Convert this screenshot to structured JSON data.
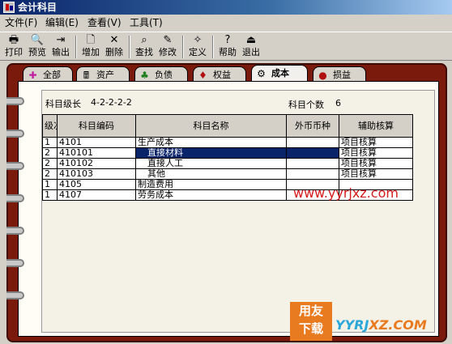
{
  "window": {
    "title": "会计科目"
  },
  "menu": [
    {
      "label": "文件(F)"
    },
    {
      "label": "编辑(E)"
    },
    {
      "label": "查看(V)"
    },
    {
      "label": "工具(T)"
    }
  ],
  "toolbar": {
    "print": "打印",
    "preview": "预览",
    "export": "输出",
    "add": "增加",
    "delete": "删除",
    "find": "查找",
    "modify": "修改",
    "define": "定义",
    "help": "帮助",
    "exit": "退出"
  },
  "tabs": [
    {
      "label": "全部",
      "icon": "all-icon"
    },
    {
      "label": "资产",
      "icon": "asset-icon"
    },
    {
      "label": "负债",
      "icon": "liability-icon"
    },
    {
      "label": "权益",
      "icon": "equity-icon"
    },
    {
      "label": "成本",
      "icon": "cost-icon",
      "active": true
    },
    {
      "label": "损益",
      "icon": "profit-loss-icon"
    }
  ],
  "info": {
    "level_length_label": "科目级长",
    "level_length_value": "4-2-2-2-2",
    "count_label": "科目个数",
    "count_value": "6"
  },
  "table": {
    "headers": [
      "级次",
      "科目编码",
      "科目名称",
      "外币币种",
      "辅助核算"
    ],
    "rows": [
      {
        "level": "1",
        "code": "4101",
        "name": "生产成本",
        "currency": "",
        "aux": "项目核算"
      },
      {
        "level": "2",
        "code": "410101",
        "name": "直接材料",
        "currency": "",
        "aux": "项目核算",
        "selected": true
      },
      {
        "level": "2",
        "code": "410102",
        "name": "直接人工",
        "currency": "",
        "aux": "项目核算"
      },
      {
        "level": "2",
        "code": "410103",
        "name": "其他",
        "currency": "",
        "aux": "项目核算"
      },
      {
        "level": "1",
        "code": "4105",
        "name": "制造费用",
        "currency": "",
        "aux": ""
      },
      {
        "level": "1",
        "code": "4107",
        "name": "劳务成本",
        "currency": "",
        "aux": ""
      }
    ]
  },
  "watermark": {
    "url": "www.yyrjxz.com",
    "logo_top": "用友",
    "logo_bottom": "下载",
    "logo_text_a": "YYRJ",
    "logo_text_b": "XZ.COM"
  },
  "colors": {
    "titlebar": "#0a246a",
    "binder": "#7a1a0c",
    "selection": "#0a246a",
    "watermark": "#d71a1a"
  }
}
